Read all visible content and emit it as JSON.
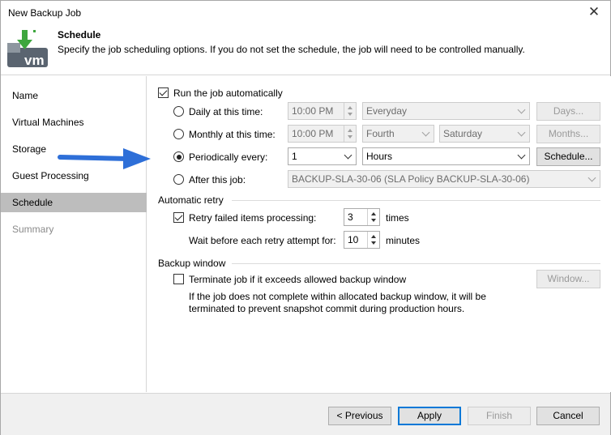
{
  "window": {
    "title": "New Backup Job",
    "close_label": "✕"
  },
  "header": {
    "title": "Schedule",
    "description": "Specify the job scheduling options. If you do not set the schedule, the job will need to be controlled manually.",
    "logo_text": "vm"
  },
  "sidebar": {
    "items": [
      {
        "label": "Name"
      },
      {
        "label": "Virtual Machines"
      },
      {
        "label": "Storage"
      },
      {
        "label": "Guest Processing"
      },
      {
        "label": "Schedule"
      },
      {
        "label": "Summary"
      }
    ]
  },
  "schedule": {
    "run_auto_label": "Run the job automatically",
    "daily_label": "Daily at this time:",
    "daily_time": "10:00 PM",
    "daily_option": "Everyday",
    "days_button": "Days...",
    "monthly_label": "Monthly at this time:",
    "monthly_time": "10:00 PM",
    "monthly_week": "Fourth",
    "monthly_day": "Saturday",
    "months_button": "Months...",
    "periodic_label": "Periodically every:",
    "periodic_value": "1",
    "periodic_unit": "Hours",
    "schedule_button": "Schedule...",
    "after_label": "After this job:",
    "after_value": "BACKUP-SLA-30-06 (SLA Policy BACKUP-SLA-30-06)"
  },
  "retry": {
    "section_label": "Automatic retry",
    "retry_label": "Retry failed items processing:",
    "retry_count": "3",
    "retry_unit": "times",
    "wait_label": "Wait before each retry attempt for:",
    "wait_value": "10",
    "wait_unit": "minutes"
  },
  "backup_window": {
    "section_label": "Backup window",
    "terminate_label": "Terminate job if it exceeds allowed backup window",
    "note_line1": "If the job does not complete within allocated backup window, it will be",
    "note_line2": "terminated to prevent snapshot commit during production hours.",
    "window_button": "Window..."
  },
  "footer": {
    "previous": "< Previous",
    "apply": "Apply",
    "finish": "Finish",
    "cancel": "Cancel"
  },
  "colors": {
    "accent_arrow": "#2e6fd8",
    "logo_green": "#3da63d",
    "logo_gray": "#5a6470",
    "active_item": "#bdbdbd"
  }
}
